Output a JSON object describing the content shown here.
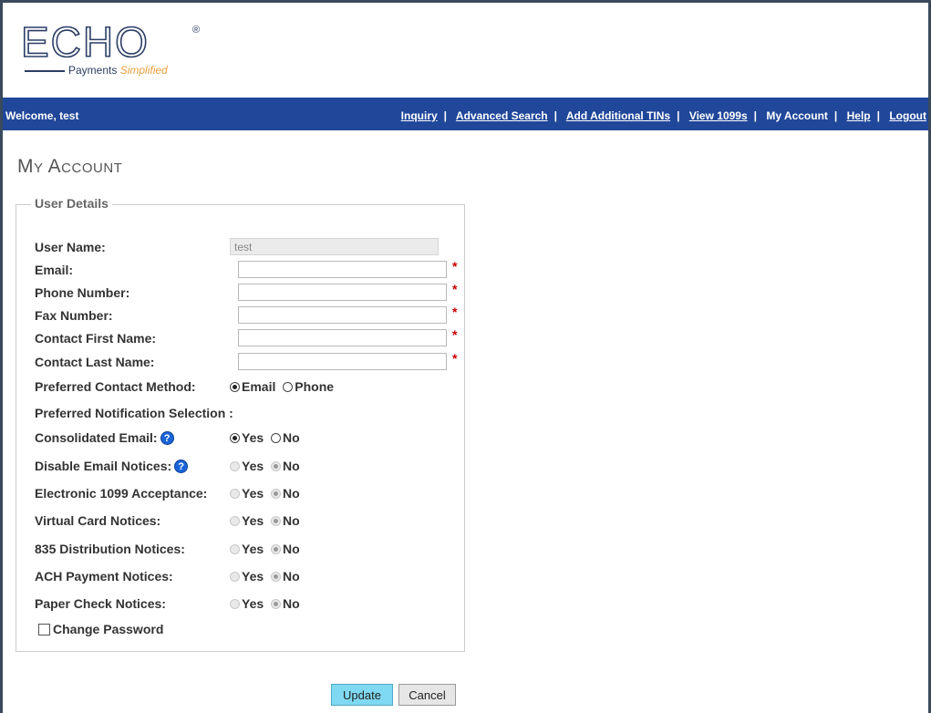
{
  "logo": {
    "brand": "ECHO",
    "registered": "®",
    "tagline_prefix": "Payments ",
    "tagline_highlight": "Simplified"
  },
  "navbar": {
    "welcome": "Welcome, test",
    "links": [
      "Inquiry",
      "Advanced Search",
      "Add Additional TINs",
      "View 1099s",
      "My Account",
      "Help",
      "Logout"
    ],
    "separator": "|"
  },
  "page": {
    "title": "My Account"
  },
  "details": {
    "legend": "User Details",
    "user_name_label": "User Name:",
    "user_name_value": "test",
    "email_label": "Email:",
    "email_value": "",
    "phone_label": "Phone Number:",
    "phone_value": "",
    "fax_label": "Fax Number:",
    "fax_value": "",
    "first_name_label": "Contact First Name:",
    "first_name_value": "",
    "last_name_label": "Contact Last Name:",
    "last_name_value": "",
    "required_mark": "*",
    "contact_method_label": "Preferred Contact Method:",
    "contact_method_options": [
      "Email",
      "Phone"
    ],
    "contact_method_selected": "Email",
    "notification_heading": "Preferred Notification Selection :",
    "yes_label": "Yes",
    "no_label": "No",
    "help_glyph": "?",
    "consolidated_label": "Consolidated Email:",
    "consolidated_selected": "Yes",
    "disable_notices_label": "Disable Email Notices:",
    "disable_notices_selected": "No",
    "electronic_1099_label": "Electronic 1099 Acceptance:",
    "electronic_1099_selected": "No",
    "virtual_card_label": "Virtual Card Notices:",
    "virtual_card_selected": "No",
    "dist_835_label": "835 Distribution Notices:",
    "dist_835_selected": "No",
    "ach_label": "ACH Payment Notices:",
    "ach_selected": "No",
    "paper_check_label": "Paper Check Notices:",
    "paper_check_selected": "No",
    "change_password_label": "Change Password"
  },
  "actions": {
    "update": "Update",
    "cancel": "Cancel"
  },
  "colors": {
    "navbar": "#20479a",
    "update_button": "#7fd9f2",
    "required": "#cc0000",
    "help_icon": "#1a64d8"
  }
}
